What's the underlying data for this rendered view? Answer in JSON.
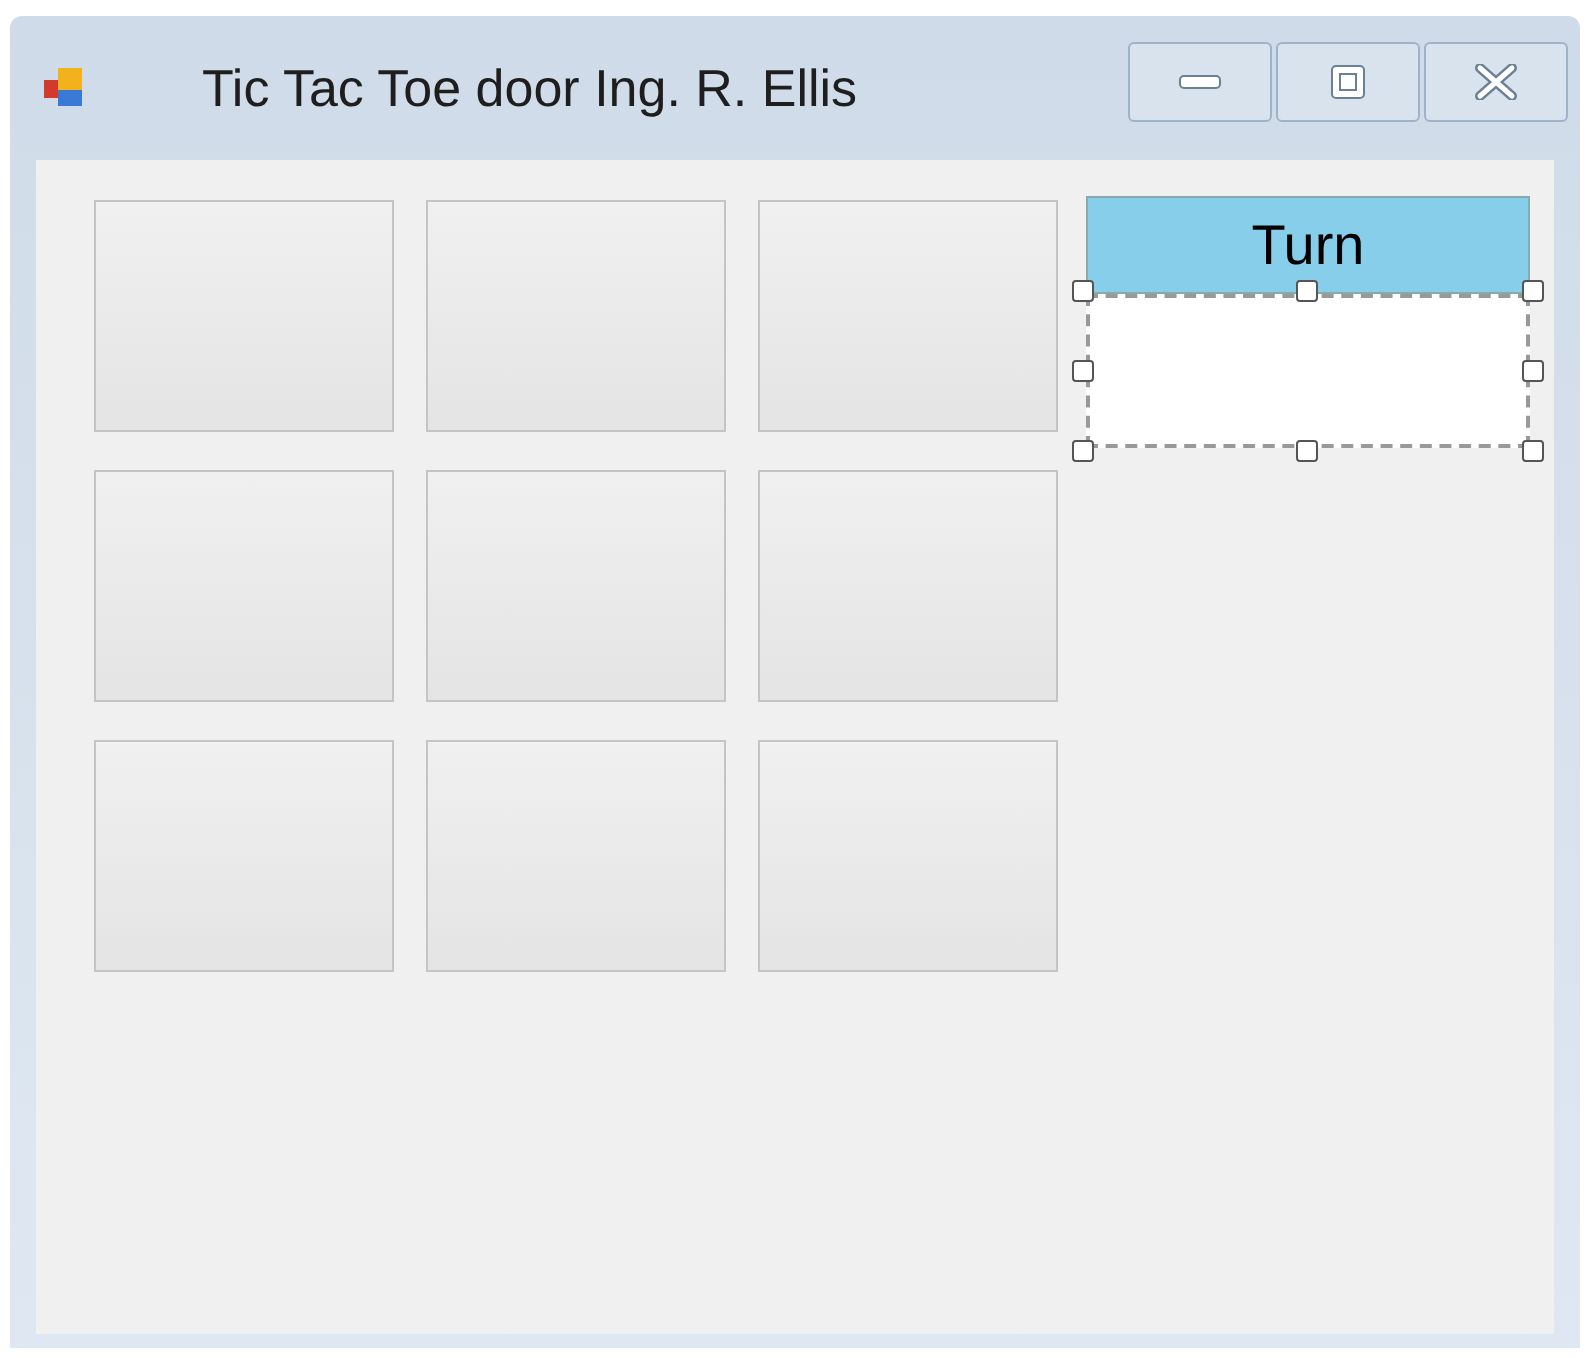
{
  "window": {
    "title": "Tic Tac Toe door Ing. R. Ellis"
  },
  "turn_label": "Turn",
  "turn_field": {
    "selected": true
  }
}
